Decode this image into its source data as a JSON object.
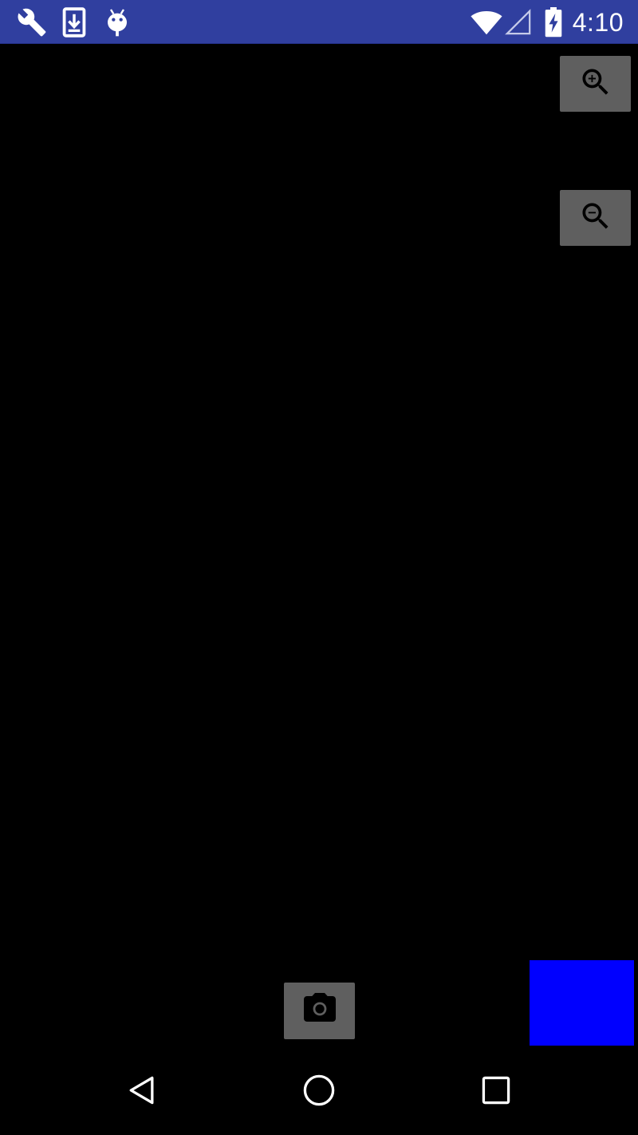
{
  "status_bar": {
    "background_color": "#303f9f",
    "left_icons": [
      "wrench-icon",
      "download-icon",
      "android-debug-icon"
    ],
    "right_icons": [
      "wifi-icon",
      "cellular-signal-icon",
      "battery-charging-icon"
    ],
    "time": "4:10"
  },
  "camera": {
    "viewfinder_color": "#000000",
    "button_color": "#5f5f5f",
    "zoom_in": {
      "icon": "zoom-in-icon"
    },
    "zoom_out": {
      "icon": "zoom-out-icon"
    },
    "capture": {
      "icon": "camera-icon"
    },
    "preview_thumbnail_color": "#0000ff"
  },
  "navigation_bar": {
    "buttons": [
      {
        "icon": "back-icon"
      },
      {
        "icon": "home-icon"
      },
      {
        "icon": "recents-icon"
      }
    ]
  }
}
